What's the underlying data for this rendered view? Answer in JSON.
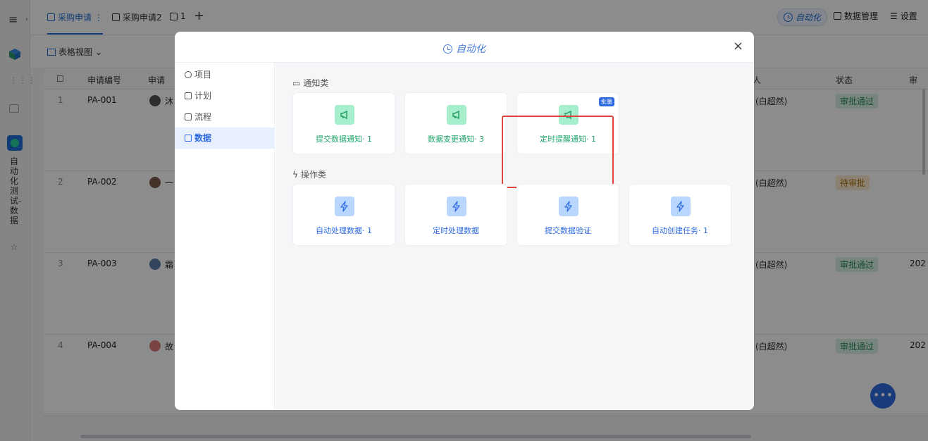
{
  "app": {
    "side_text": "自动化测试-数据",
    "tabs": [
      {
        "label": "采购申请"
      },
      {
        "label": "采购申请2"
      },
      {
        "label": "1"
      }
    ],
    "tab_more": "⋮",
    "tab_add": "+",
    "top_actions": {
      "automation": "自动化",
      "data_manage": "数据管理",
      "settings": "设置"
    },
    "view_label": "表格视图",
    "grid": {
      "headers": [
        "申请编号",
        "申请",
        "人",
        "状态",
        "审"
      ],
      "rows": [
        {
          "num": "1",
          "code": "PA-001",
          "name": "沐",
          "owner": "(白超然)",
          "status": "审批通过",
          "status_type": "ok",
          "date": ""
        },
        {
          "num": "2",
          "code": "PA-002",
          "name": "一",
          "owner": "(白超然)",
          "status": "待审批",
          "status_type": "wait",
          "date": ""
        },
        {
          "num": "3",
          "code": "PA-003",
          "name": "霜",
          "owner": "(白超然)",
          "status": "审批通过",
          "status_type": "ok",
          "date": "202"
        },
        {
          "num": "4",
          "code": "PA-004",
          "name": "故",
          "owner": "(白超然)",
          "status": "审批通过",
          "status_type": "ok",
          "date": "202"
        }
      ]
    },
    "fab": "•••"
  },
  "modal": {
    "title": "自动化",
    "close": "×",
    "side": [
      {
        "label": "项目",
        "active": false
      },
      {
        "label": "计划",
        "active": false
      },
      {
        "label": "流程",
        "active": false
      },
      {
        "label": "数据",
        "active": true
      }
    ],
    "notify_section": "通知类",
    "notify_cards": [
      {
        "label": "提交数据通知· 1",
        "badge": ""
      },
      {
        "label": "数据变更通知· 3",
        "badge": "",
        "highlighted": true
      },
      {
        "label": "定时提醒通知· 1",
        "badge": "批量"
      }
    ],
    "action_section": "操作类",
    "action_cards": [
      {
        "label": "自动处理数据· 1"
      },
      {
        "label": "定时处理数据"
      },
      {
        "label": "提交数据验证"
      },
      {
        "label": "自动创建任务· 1"
      }
    ]
  },
  "colors": {
    "accent": "#2e6be0",
    "notify_green": "#22a56a",
    "highlight_red": "#e0463c"
  }
}
